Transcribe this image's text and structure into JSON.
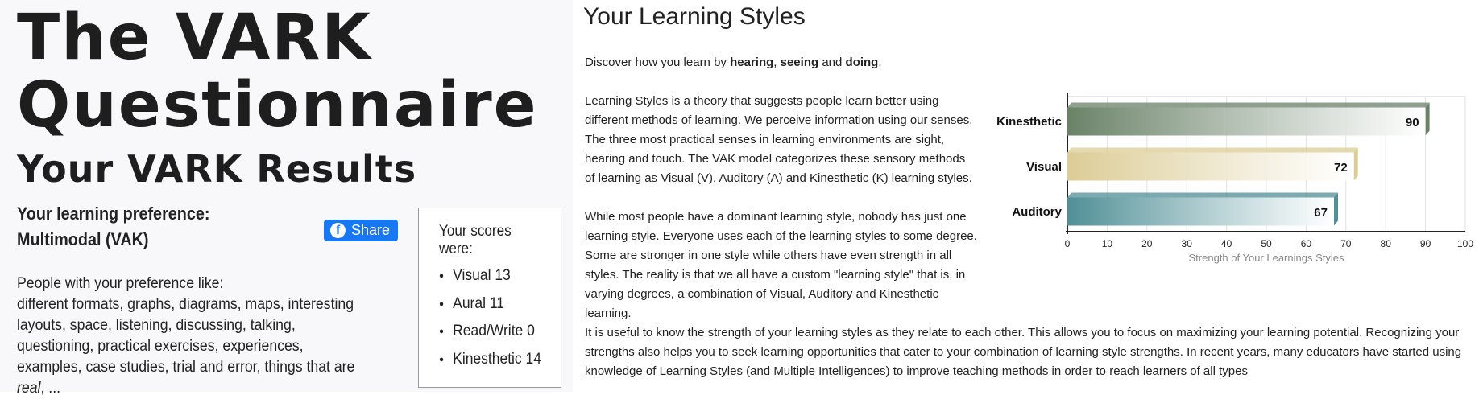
{
  "left": {
    "title": "The VARK Questionnaire",
    "subtitle": "Your VARK Results",
    "preference_label": "Your learning preference:",
    "preference_value": "Multimodal (VAK)",
    "share_label": "Share",
    "people_intro": "People with your preference like:",
    "people_text": "different formats, graphs, diagrams, maps, interesting layouts, space, listening, discussing, talking, questioning, practical exercises, experiences, examples, case studies, trial and error, things that are",
    "people_emph": "real",
    "people_tail": ", ...",
    "scores_title": "Your scores were:",
    "scores": [
      "Visual 13",
      "Aural 11",
      "Read/Write 0",
      "Kinesthetic 14"
    ]
  },
  "right": {
    "title": "Your Learning Styles",
    "intro": {
      "prefix": "Discover how you learn by ",
      "w1": "hearing",
      "sep1": ", ",
      "w2": "seeing",
      "sep2": " and ",
      "w3": "doing",
      "end": "."
    },
    "p1": "Learning Styles is a theory that suggests people learn better using different methods of learning. We perceive information using our senses. The three most practical senses in learning environments are sight, hearing and touch. The VAK model categorizes these sensory methods of learning as Visual (V), Auditory (A) and Kinesthetic (K) learning styles.",
    "p2": "While most people have a dominant learning style, nobody has just one learning style. Everyone uses each of the learning styles to some degree. Some are stronger in one style while others have even strength in all styles. The reality is that we all have a custom \"learning style\" that is, in varying degrees, a combination of Visual, Auditory and Kinesthetic learning.",
    "p3": "It is useful to know the strength of your learning styles as they relate to each other. This allows you to focus on maximizing your learning potential. Recognizing your strengths also helps you to seek learning opportunities that cater to your combination of learning style strengths. In recent years, many educators have started using knowledge of Learning Styles (and Multiple Intelligences) to improve teaching methods in order to reach learners of all types"
  },
  "chart_data": {
    "type": "bar",
    "orientation": "horizontal",
    "categories": [
      "Kinesthetic",
      "Visual",
      "Auditory"
    ],
    "values": [
      90,
      72,
      67
    ],
    "colors": [
      "#6a8268",
      "#dccc96",
      "#4f8f96"
    ],
    "xlabel": "Strength of Your Learnings Styles",
    "xlim": [
      0,
      100
    ],
    "xticks": [
      0,
      10,
      20,
      30,
      40,
      50,
      60,
      70,
      80,
      90,
      100
    ],
    "grid": true
  }
}
